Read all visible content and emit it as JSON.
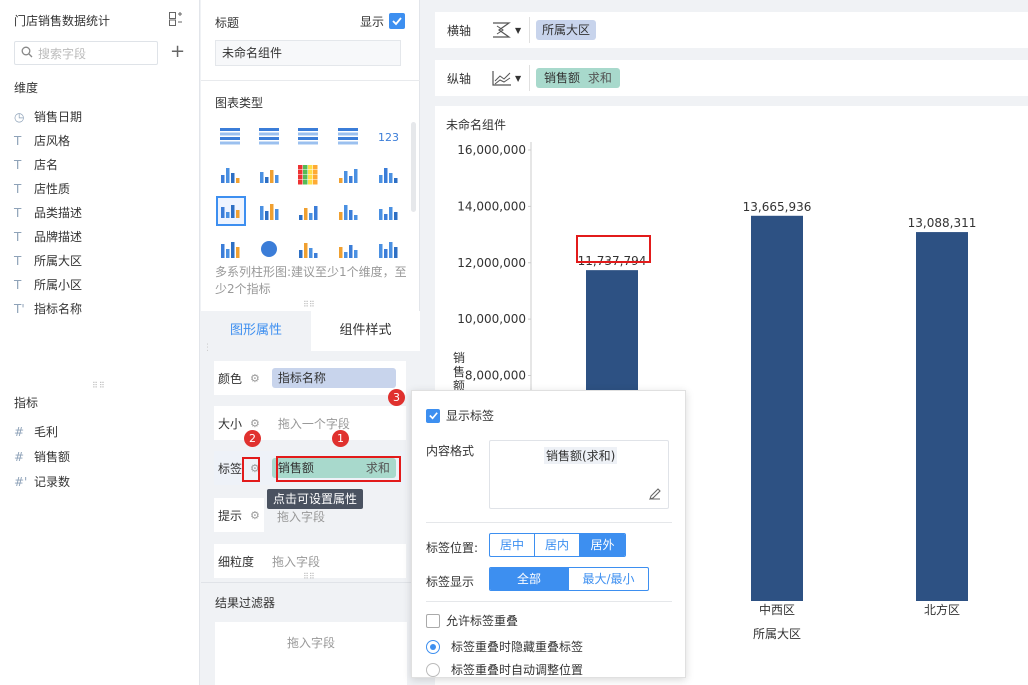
{
  "left": {
    "title": "门店销售数据统计",
    "search_placeholder": "搜索字段",
    "dim_title": "维度",
    "dimensions": [
      {
        "icon": "clock-icon",
        "glyph": "◷",
        "label": "销售日期"
      },
      {
        "icon": "text-type-icon",
        "glyph": "T",
        "label": "店风格"
      },
      {
        "icon": "text-type-icon",
        "glyph": "T",
        "label": "店名"
      },
      {
        "icon": "text-type-icon",
        "glyph": "T",
        "label": "店性质"
      },
      {
        "icon": "text-type-icon",
        "glyph": "T",
        "label": "品类描述"
      },
      {
        "icon": "text-type-icon",
        "glyph": "T",
        "label": "品牌描述"
      },
      {
        "icon": "text-type-icon",
        "glyph": "T",
        "label": "所属大区"
      },
      {
        "icon": "text-type-icon",
        "glyph": "T",
        "label": "所属小区"
      },
      {
        "icon": "text-type-icon",
        "glyph": "T'",
        "label": "指标名称"
      }
    ],
    "measure_title": "指标",
    "measures": [
      {
        "icon": "hash-icon",
        "glyph": "#",
        "label": "毛利"
      },
      {
        "icon": "hash-icon",
        "glyph": "#",
        "label": "销售额"
      },
      {
        "icon": "hash-icon",
        "glyph": "#'",
        "label": "记录数"
      }
    ]
  },
  "mid": {
    "title_label": "标题",
    "show_label": "显示",
    "title_value": "未命名组件",
    "chart_type_label": "图表类型",
    "chart_hint": "多系列柱形图:建议至少1个维度，至少2个指标",
    "tab_graph": "图形属性",
    "tab_style": "组件样式",
    "color_label": "颜色",
    "color_field": "指标名称",
    "size_label": "大小",
    "size_placeholder": "拖入一个字段",
    "label_label": "标签",
    "label_field": "销售额",
    "label_agg": "求和",
    "tooltip_text": "点击可设置属性",
    "hint_label": "提示",
    "hint_placeholder": "拖入字段",
    "gran_label": "细粒度",
    "gran_placeholder": "拖入字段",
    "filter_title": "结果过滤器",
    "filter_placeholder": "拖入字段"
  },
  "right": {
    "x_axis_label": "横轴",
    "x_field": "所属大区",
    "y_axis_label": "纵轴",
    "y_field": "销售额",
    "y_agg": "求和",
    "component_title": "未命名组件"
  },
  "chart_data": {
    "type": "bar",
    "categories": [
      "",
      "中西区",
      "北方区"
    ],
    "values": [
      11737794,
      13665936,
      13088311
    ],
    "value_labels": [
      "11,737,794",
      "13,665,936",
      "13,088,311"
    ],
    "xlabel": "所属大区",
    "ylabel": "销售额",
    "yticks": [
      "16,000,000",
      "14,000,000",
      "12,000,000",
      "10,000,000",
      "8,000,000"
    ],
    "ylim": [
      0,
      16000000
    ],
    "color": "#2d5183"
  },
  "popup": {
    "show_label": "显示标签",
    "content_format": "内容格式",
    "content_value": "销售额(求和)",
    "position_label": "标签位置:",
    "positions": [
      "居中",
      "居内",
      "居外"
    ],
    "display_label": "标签显示",
    "displays": [
      "全部",
      "最大/最小"
    ],
    "allow_overlap": "允许标签重叠",
    "opt_hide": "标签重叠时隐藏重叠标签",
    "opt_auto": "标签重叠时自动调整位置"
  },
  "badges": [
    "1",
    "2",
    "3"
  ]
}
